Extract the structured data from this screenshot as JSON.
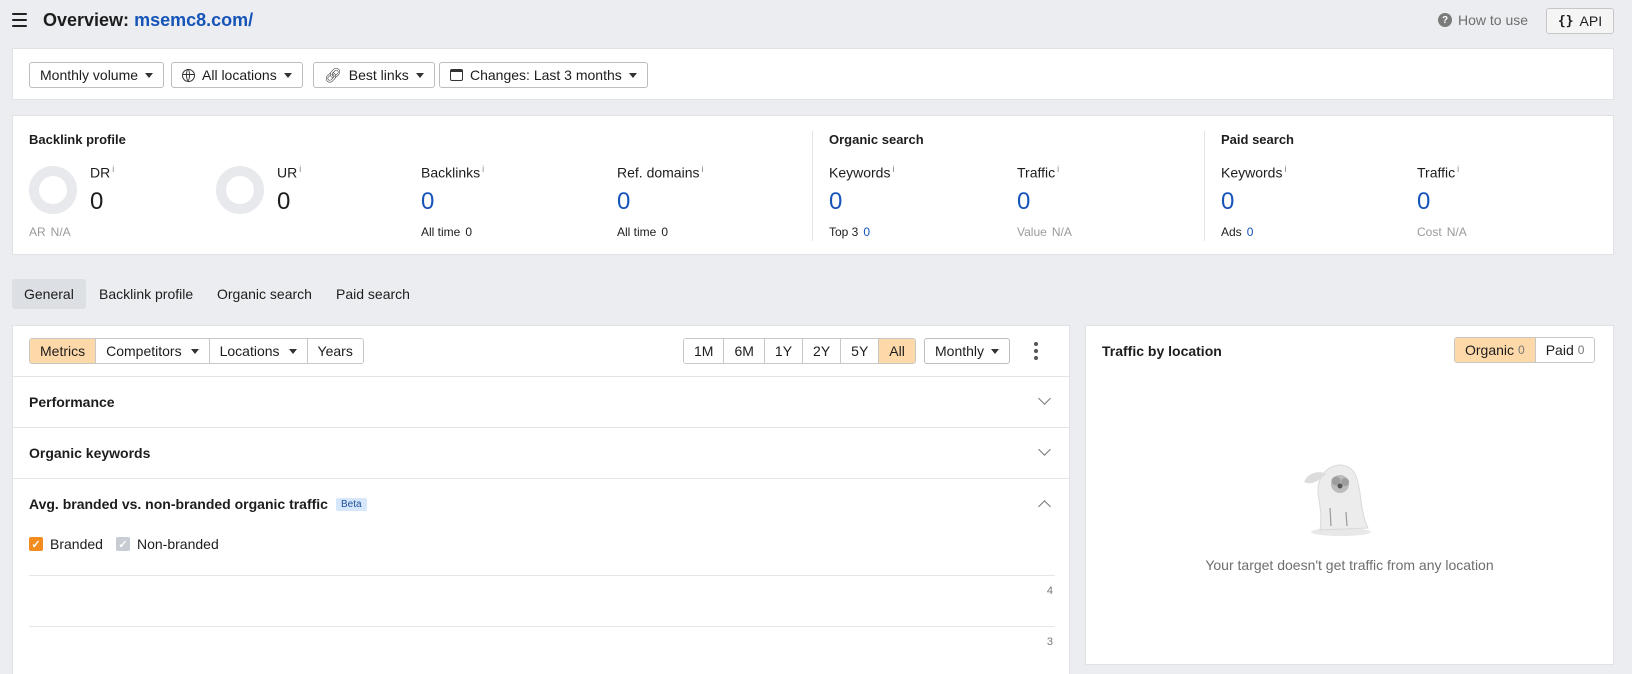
{
  "header": {
    "title_prefix": "Overview:",
    "target": "msemc8.com/",
    "how_to_use": "How to use",
    "api_icon": "{}",
    "api_label": "API",
    "icons": {
      "menu": "hamburger-icon",
      "help": "question-circle-icon",
      "api": "braces-icon"
    }
  },
  "filters": {
    "volume": "Monthly volume",
    "locations": "All locations",
    "links": "Best links",
    "changes": "Changes: Last 3 months",
    "icons": {
      "locations": "globe-icon",
      "links": "link-icon",
      "changes": "calendar-icon"
    }
  },
  "stats": {
    "backlink_profile": {
      "title": "Backlink profile",
      "dr": {
        "label": "DR",
        "info": "i",
        "value": "0"
      },
      "ur": {
        "label": "UR",
        "info": "i",
        "value": "0"
      },
      "ar": {
        "label": "AR",
        "value": "N/A"
      },
      "backlinks": {
        "label": "Backlinks",
        "info": "i",
        "value": "0",
        "sub_label": "All time",
        "sub_value": "0"
      },
      "ref_domains": {
        "label": "Ref. domains",
        "info": "i",
        "value": "0",
        "sub_label": "All time",
        "sub_value": "0"
      }
    },
    "organic_search": {
      "title": "Organic search",
      "keywords": {
        "label": "Keywords",
        "info": "i",
        "value": "0",
        "sub_label": "Top 3",
        "sub_value": "0"
      },
      "traffic": {
        "label": "Traffic",
        "info": "i",
        "value": "0",
        "sub_label": "Value",
        "sub_value": "N/A"
      }
    },
    "paid_search": {
      "title": "Paid search",
      "keywords": {
        "label": "Keywords",
        "info": "i",
        "value": "0",
        "sub_label": "Ads",
        "sub_value": "0"
      },
      "traffic": {
        "label": "Traffic",
        "info": "i",
        "value": "0",
        "sub_label": "Cost",
        "sub_value": "N/A"
      }
    }
  },
  "tabs": [
    {
      "label": "General",
      "active": true
    },
    {
      "label": "Backlink profile",
      "active": false
    },
    {
      "label": "Organic search",
      "active": false
    },
    {
      "label": "Paid search",
      "active": false
    }
  ],
  "main": {
    "view_toggle": [
      {
        "label": "Metrics",
        "active": true
      },
      {
        "label": "Competitors",
        "dropdown": true
      },
      {
        "label": "Locations",
        "dropdown": true
      },
      {
        "label": "Years"
      }
    ],
    "ranges": [
      {
        "label": "1M"
      },
      {
        "label": "6M"
      },
      {
        "label": "1Y"
      },
      {
        "label": "2Y"
      },
      {
        "label": "5Y"
      },
      {
        "label": "All",
        "active": true
      }
    ],
    "interval": "Monthly",
    "sections": {
      "performance": "Performance",
      "organic_keywords": "Organic keywords",
      "branded": "Avg. branded vs. non-branded organic traffic",
      "beta": "Beta"
    },
    "legend": {
      "branded": "Branded",
      "non_branded": "Non-branded",
      "check": "✓"
    },
    "y_ticks": [
      "4",
      "3"
    ]
  },
  "traffic_by_location": {
    "title": "Traffic by location",
    "organic_label": "Organic",
    "organic_count": "0",
    "paid_label": "Paid",
    "paid_count": "0",
    "empty_message": "Your target doesn't get traffic from any location",
    "illustration": "ghost-koala-illustration"
  },
  "colors": {
    "accent_blue": "#1554b8",
    "toggle_active": "#fdd8a9",
    "checkbox_orange": "#f28c1e"
  }
}
